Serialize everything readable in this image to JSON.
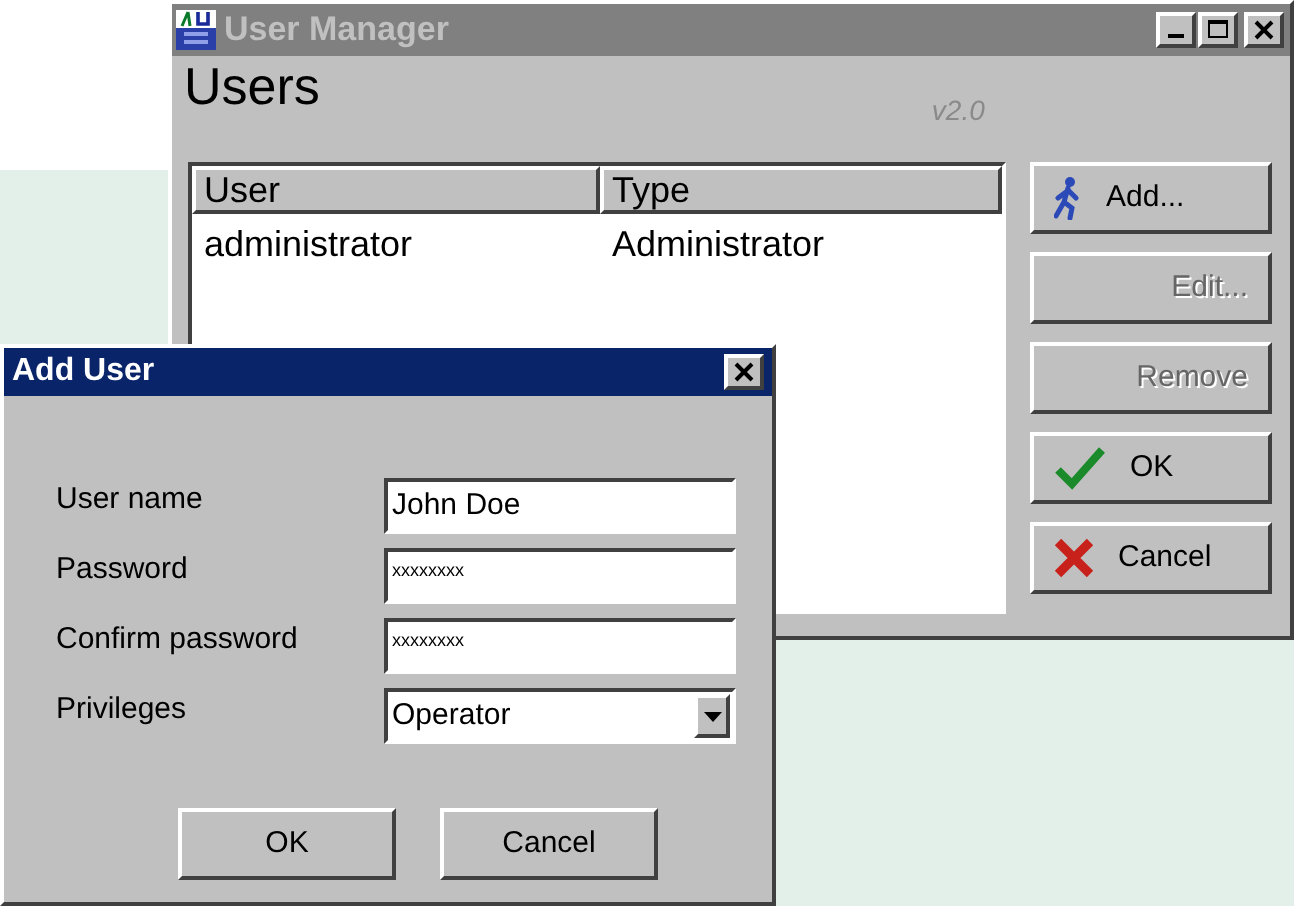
{
  "main_window": {
    "title": "User Manager",
    "active": false,
    "heading": "Users",
    "version": "v2.0",
    "table": {
      "columns": [
        "User",
        "Type"
      ],
      "rows": [
        [
          "administrator",
          "Administrator"
        ]
      ]
    },
    "buttons": [
      {
        "label": "Add...",
        "kind": "walker",
        "disabled": false
      },
      {
        "label": "Edit...",
        "disabled": true
      },
      {
        "label": "Remove",
        "disabled": true
      },
      {
        "label": "OK",
        "kind": "check",
        "disabled": false
      },
      {
        "label": "Cancel",
        "kind": "cross",
        "disabled": false
      }
    ]
  },
  "dialog": {
    "title": "Add User",
    "active": true,
    "fields": [
      {
        "label": "User name",
        "value": "John Doe",
        "kind": "text"
      },
      {
        "label": "Password",
        "value": "xxxxxxxx",
        "kind": "password"
      },
      {
        "label": "Confirm password",
        "value": "xxxxxxxx",
        "kind": "password"
      },
      {
        "label": "Privileges",
        "value": "Operator",
        "kind": "dropdown"
      }
    ],
    "buttons": [
      "OK",
      "Cancel"
    ]
  }
}
